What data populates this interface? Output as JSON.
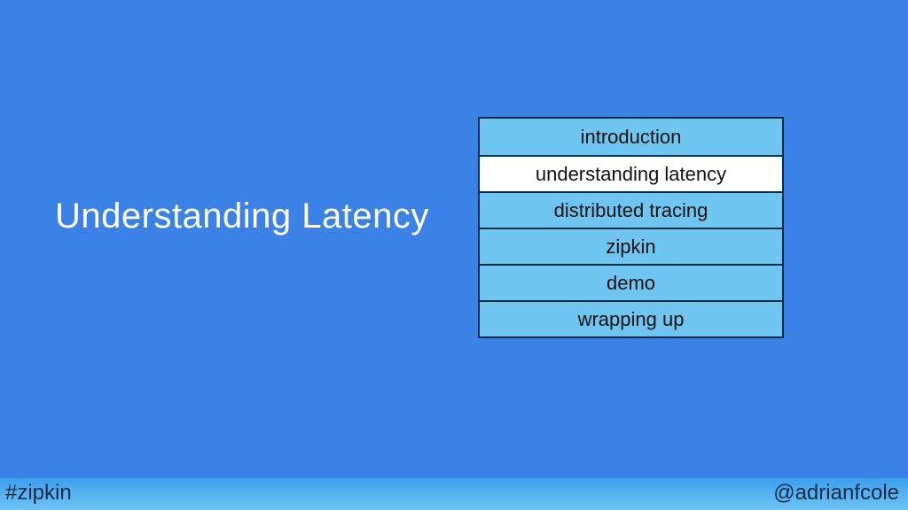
{
  "title": "Understanding Latency",
  "agenda": {
    "items": [
      {
        "label": "introduction",
        "active": false
      },
      {
        "label": "understanding latency",
        "active": true
      },
      {
        "label": "distributed tracing",
        "active": false
      },
      {
        "label": "zipkin",
        "active": false
      },
      {
        "label": "demo",
        "active": false
      },
      {
        "label": "wrapping up",
        "active": false
      }
    ]
  },
  "footer": {
    "hashtag": "#zipkin",
    "handle": "@adrianfcole"
  }
}
